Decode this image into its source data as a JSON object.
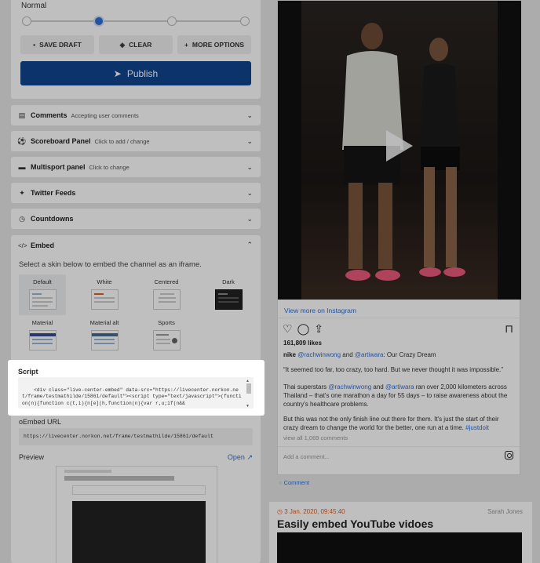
{
  "priority": {
    "label": "Normal",
    "level": 2,
    "levels": 4
  },
  "actions": {
    "save_draft": "SAVE DRAFT",
    "clear": "CLEAR",
    "more_options": "MORE OPTIONS",
    "publish": "Publish"
  },
  "accordions": [
    {
      "title": "Comments",
      "sub": "Accepting user comments",
      "icon": "comments-icon"
    },
    {
      "title": "Scoreboard Panel",
      "sub": "Click to add / change",
      "icon": "soccer-ball-icon"
    },
    {
      "title": "Multisport panel",
      "sub": "Click to change",
      "icon": "briefcase-icon"
    },
    {
      "title": "Twitter Feeds",
      "sub": "",
      "icon": "twitter-icon"
    },
    {
      "title": "Countdowns",
      "sub": "",
      "icon": "clock-icon"
    }
  ],
  "embed": {
    "title": "Embed",
    "description": "Select a skin below to embed the channel as an iframe.",
    "skins": [
      "Default",
      "White",
      "Centered",
      "Dark",
      "Material",
      "Material alt",
      "Sports"
    ],
    "selected_skin": "Default",
    "script_label": "Script",
    "script_code": "<div class=\"live-center-embed\" data-src=\"https://livecenter.norkon.net/frame/testmathilde/15861/default\"><script type=\"text/javascript\">(function(n){function c(t,i){n[e](h,function(n){var r,u;if(n&&",
    "oembed_label": "oEmbed URL",
    "oembed_url": "https://livecenter.norkon.net/frame/testmathilde/15861/default",
    "preview_label": "Preview",
    "open_label": "Open"
  },
  "instagram": {
    "view_more": "View more on Instagram",
    "likes": "161,809 likes",
    "caption_user": "nike",
    "caption_mention1": "@rachwinwong",
    "caption_and": "and",
    "caption_mention2": "@artiwara",
    "caption_rest": ": Our Crazy Dream",
    "quote": "“It seemed too far, too crazy, too hard. But we never thought it was impossible.”",
    "para1_a": "Thai superstars ",
    "para1_m1": "@rachwinwong",
    "para1_b": " and ",
    "para1_m2": "@artiwara",
    "para1_c": " ran over 2,000 kilometers across Thailand – that's one marathon a day for 55 days – to raise awareness about the country's healthcare problems.",
    "para2": "But this was not the only finish line out there for them. It's just the start of their crazy dream to change the world for the better, one run at a time.",
    "para2_tag": "#justdoit",
    "view_all": "view all 1,069 comments",
    "add_comment": "Add a comment..."
  },
  "post": {
    "comment_link": "Comment",
    "date": "3 Jan. 2020, 09:45:40",
    "author": "Sarah Jones",
    "title": "Easily embed YouTube vidoes"
  },
  "colors": {
    "accent": "#11468f",
    "link": "#2f6fd6",
    "date": "#e35b1f"
  }
}
